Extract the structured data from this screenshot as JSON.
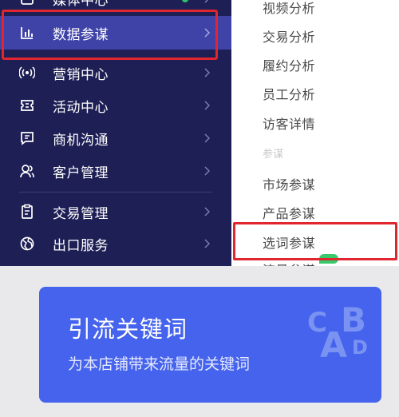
{
  "sidebar": {
    "items": [
      {
        "label": "媒体中心",
        "icon": "media-icon",
        "active": false
      },
      {
        "label": "数据参谋",
        "icon": "bar-chart-icon",
        "active": true
      },
      {
        "label": "营销中心",
        "icon": "broadcast-icon",
        "active": false
      },
      {
        "label": "活动中心",
        "icon": "ticket-icon",
        "active": false
      },
      {
        "label": "商机沟通",
        "icon": "chat-icon",
        "active": false
      },
      {
        "label": "客户管理",
        "icon": "users-icon",
        "active": false
      },
      {
        "label": "交易管理",
        "icon": "clipboard-icon",
        "active": false
      },
      {
        "label": "出口服务",
        "icon": "globe-icon",
        "active": false
      }
    ]
  },
  "submenu": {
    "items": [
      "视频分析",
      "交易分析",
      "履约分析",
      "员工分析",
      "访客详情",
      "市场参谋",
      "产品参谋",
      "选词参谋",
      "流量参谋"
    ],
    "group_label": "参谋",
    "highlighted": "选词参谋"
  },
  "card": {
    "title": "引流关键词",
    "description": "为本店铺带来流量的关键词",
    "art_letters": [
      "C",
      "A",
      "B",
      "D"
    ]
  },
  "colors": {
    "sidebar_bg": "#1e1f55",
    "active_bg": "#3f43a7",
    "highlight_border": "#e0262e",
    "card_bg": "#4563ec",
    "badge_green": "#38c96a"
  }
}
